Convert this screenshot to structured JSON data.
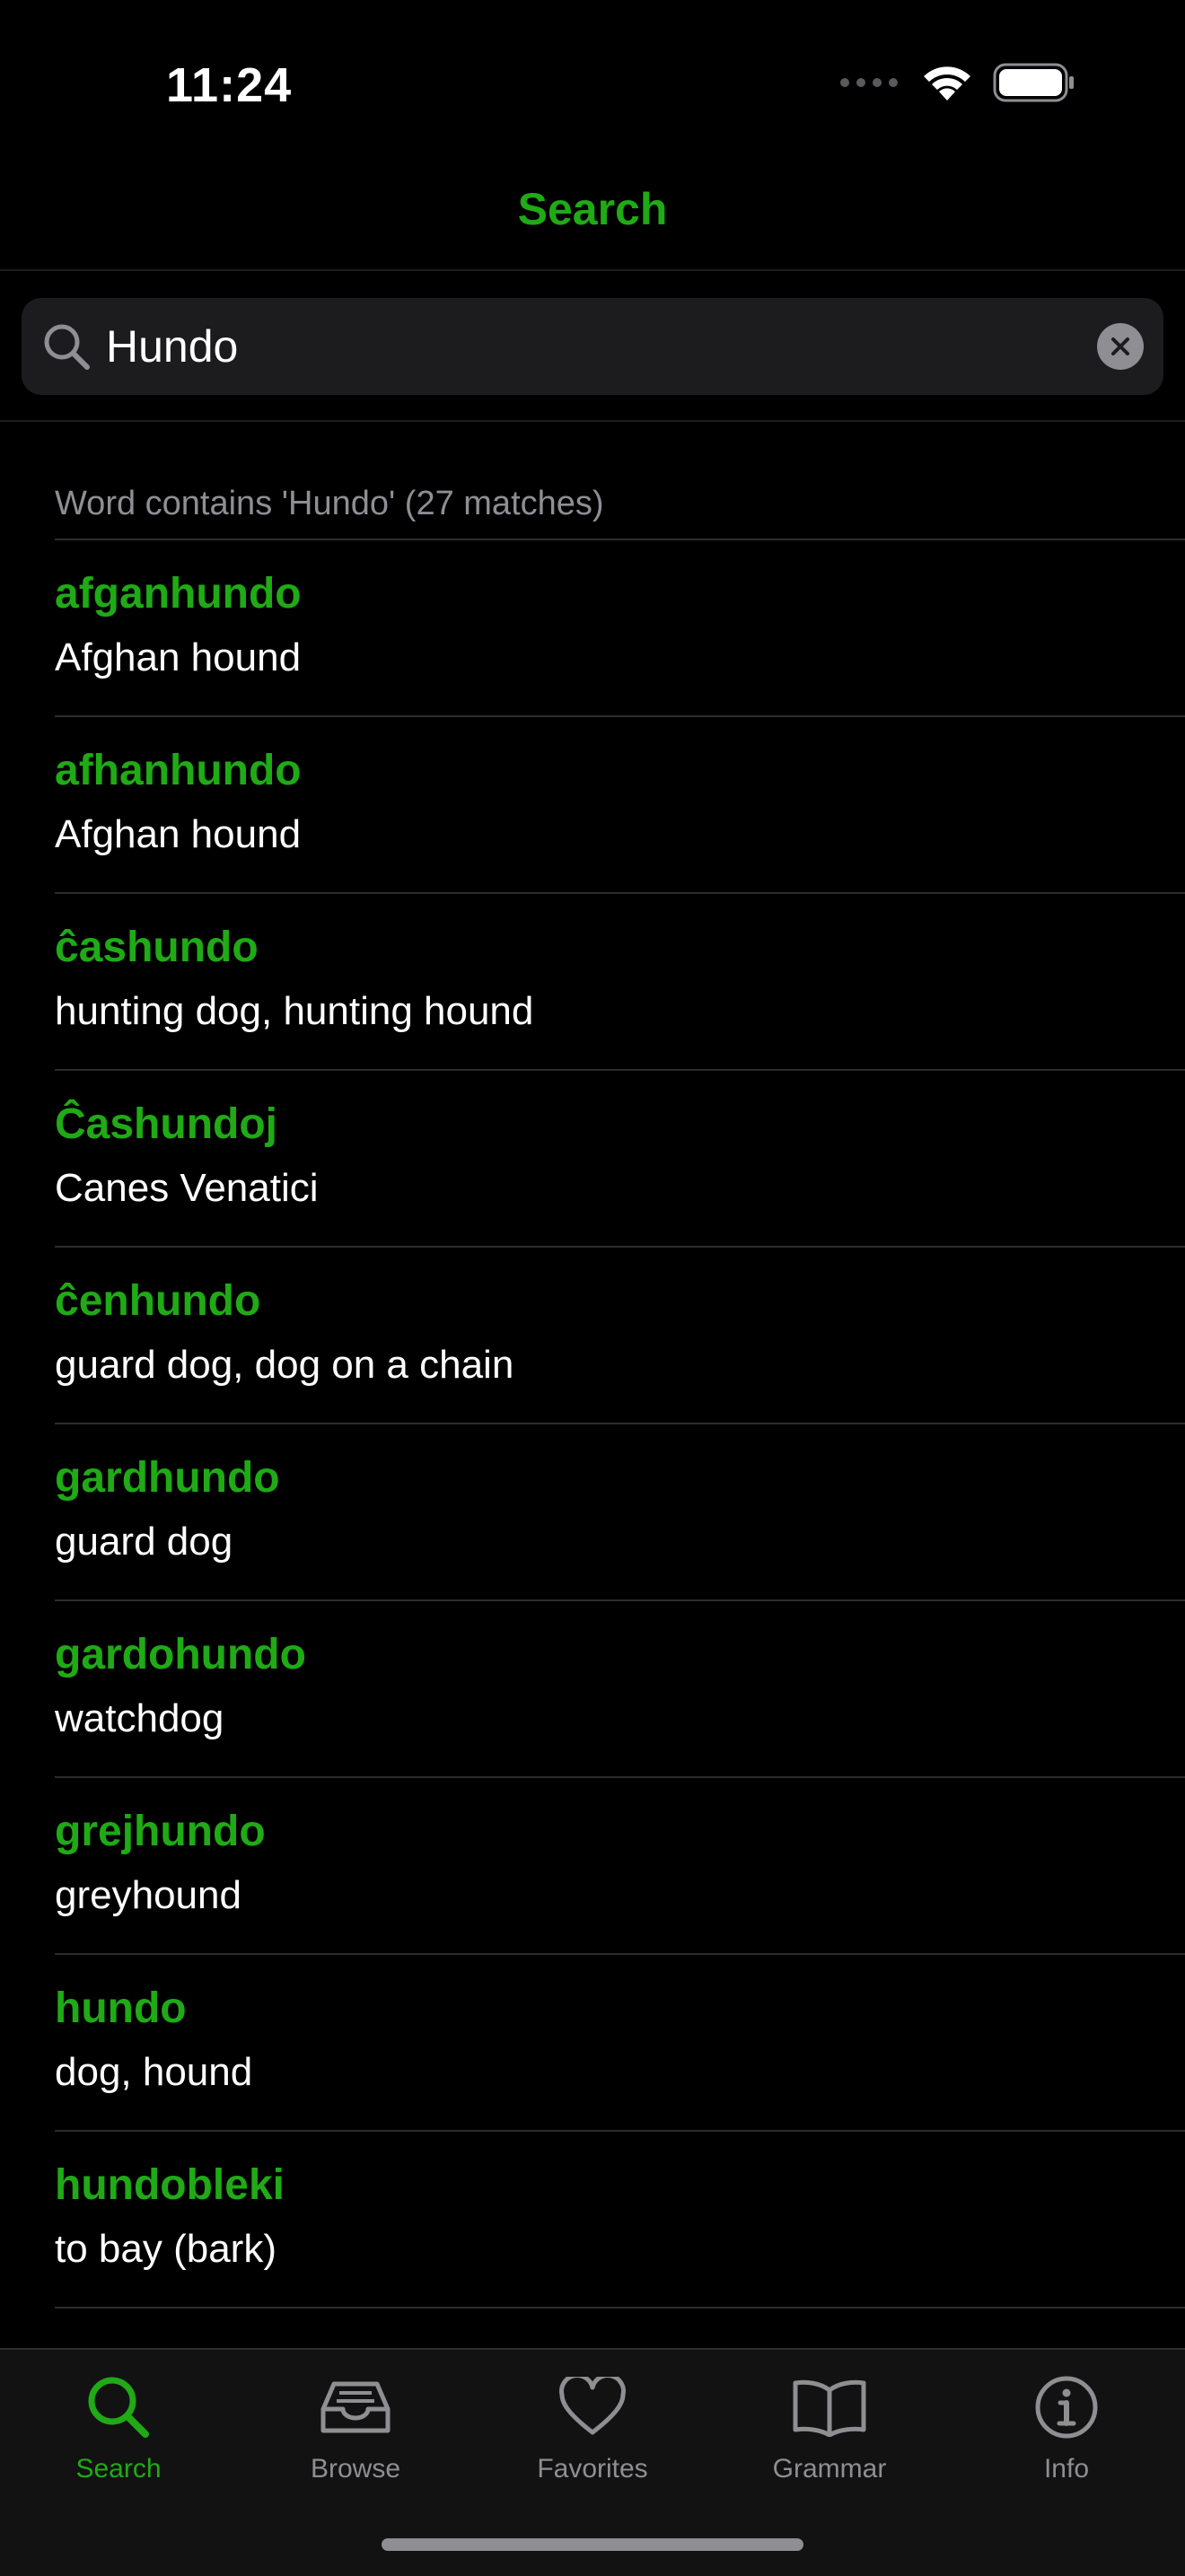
{
  "status_bar": {
    "time": "11:24"
  },
  "nav": {
    "title": "Search"
  },
  "search": {
    "value": "Hundo",
    "placeholder": "Search"
  },
  "results": {
    "header": "Word contains 'Hundo' (27 matches)",
    "items": [
      {
        "word": "afganhundo",
        "meaning": "Afghan hound"
      },
      {
        "word": "afhanhundo",
        "meaning": "Afghan hound"
      },
      {
        "word": "ĉashundo",
        "meaning": "hunting dog, hunting hound"
      },
      {
        "word": "Ĉashundoj",
        "meaning": "Canes Venatici"
      },
      {
        "word": "ĉenhundo",
        "meaning": "guard dog, dog on a chain"
      },
      {
        "word": "gardhundo",
        "meaning": "guard dog"
      },
      {
        "word": "gardohundo",
        "meaning": "watchdog"
      },
      {
        "word": "grejhundo",
        "meaning": "greyhound"
      },
      {
        "word": "hundo",
        "meaning": "dog, hound"
      },
      {
        "word": "hundobleki",
        "meaning": "to bay (bark)"
      }
    ]
  },
  "tabs": [
    {
      "label": "Search",
      "icon": "search-icon",
      "active": true
    },
    {
      "label": "Browse",
      "icon": "tray-icon",
      "active": false
    },
    {
      "label": "Favorites",
      "icon": "heart-icon",
      "active": false
    },
    {
      "label": "Grammar",
      "icon": "book-icon",
      "active": false
    },
    {
      "label": "Info",
      "icon": "info-icon",
      "active": false
    }
  ],
  "colors": {
    "accent": "#1faa16",
    "background": "#000000",
    "secondary_text": "#8e8e93"
  }
}
